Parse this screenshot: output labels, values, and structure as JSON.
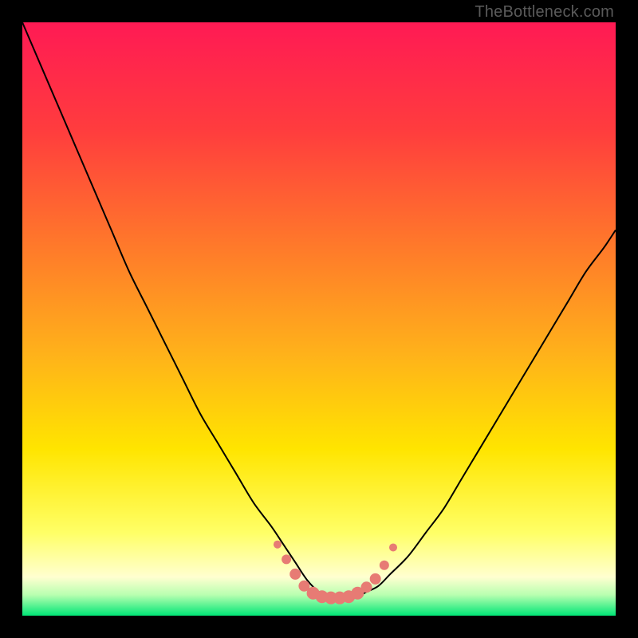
{
  "watermark": "TheBottleneck.com",
  "chart_data": {
    "type": "line",
    "title": "",
    "xlabel": "",
    "ylabel": "",
    "xlim": [
      0,
      100
    ],
    "ylim": [
      0,
      100
    ],
    "grid": false,
    "legend": false,
    "background_gradient": {
      "type": "linear-vertical",
      "stops": [
        {
          "pos": 0.0,
          "color": "#ff1a54"
        },
        {
          "pos": 0.18,
          "color": "#ff3c3e"
        },
        {
          "pos": 0.38,
          "color": "#ff7a2a"
        },
        {
          "pos": 0.56,
          "color": "#ffb21a"
        },
        {
          "pos": 0.72,
          "color": "#ffe500"
        },
        {
          "pos": 0.86,
          "color": "#ffff66"
        },
        {
          "pos": 0.935,
          "color": "#ffffd0"
        },
        {
          "pos": 0.965,
          "color": "#b8ffb0"
        },
        {
          "pos": 1.0,
          "color": "#00e676"
        }
      ]
    },
    "series": [
      {
        "name": "bottleneck-curve",
        "color": "#000000",
        "stroke_width": 2,
        "x": [
          0,
          3,
          6,
          9,
          12,
          15,
          18,
          21,
          24,
          27,
          30,
          33,
          36,
          39,
          42,
          44,
          46,
          48,
          50,
          52,
          54,
          56,
          58,
          60,
          62,
          65,
          68,
          71,
          74,
          77,
          80,
          83,
          86,
          89,
          92,
          95,
          98,
          100
        ],
        "y": [
          100,
          93,
          86,
          79,
          72,
          65,
          58,
          52,
          46,
          40,
          34,
          29,
          24,
          19,
          15,
          12,
          9,
          6,
          4,
          3,
          3,
          3,
          4,
          5,
          7,
          10,
          14,
          18,
          23,
          28,
          33,
          38,
          43,
          48,
          53,
          58,
          62,
          65
        ]
      }
    ],
    "markers": {
      "name": "flat-bottom-markers",
      "color": "#e77b74",
      "radius_major": 8,
      "radius_minor": 5,
      "points": [
        {
          "x": 43.0,
          "y": 12.0,
          "r": 5
        },
        {
          "x": 44.5,
          "y": 9.5,
          "r": 6
        },
        {
          "x": 46.0,
          "y": 7.0,
          "r": 7
        },
        {
          "x": 47.5,
          "y": 5.0,
          "r": 7
        },
        {
          "x": 49.0,
          "y": 3.8,
          "r": 8
        },
        {
          "x": 50.5,
          "y": 3.2,
          "r": 8
        },
        {
          "x": 52.0,
          "y": 3.0,
          "r": 8
        },
        {
          "x": 53.5,
          "y": 3.0,
          "r": 8
        },
        {
          "x": 55.0,
          "y": 3.2,
          "r": 8
        },
        {
          "x": 56.5,
          "y": 3.8,
          "r": 8
        },
        {
          "x": 58.0,
          "y": 4.8,
          "r": 7
        },
        {
          "x": 59.5,
          "y": 6.2,
          "r": 7
        },
        {
          "x": 61.0,
          "y": 8.5,
          "r": 6
        },
        {
          "x": 62.5,
          "y": 11.5,
          "r": 5
        }
      ]
    }
  }
}
